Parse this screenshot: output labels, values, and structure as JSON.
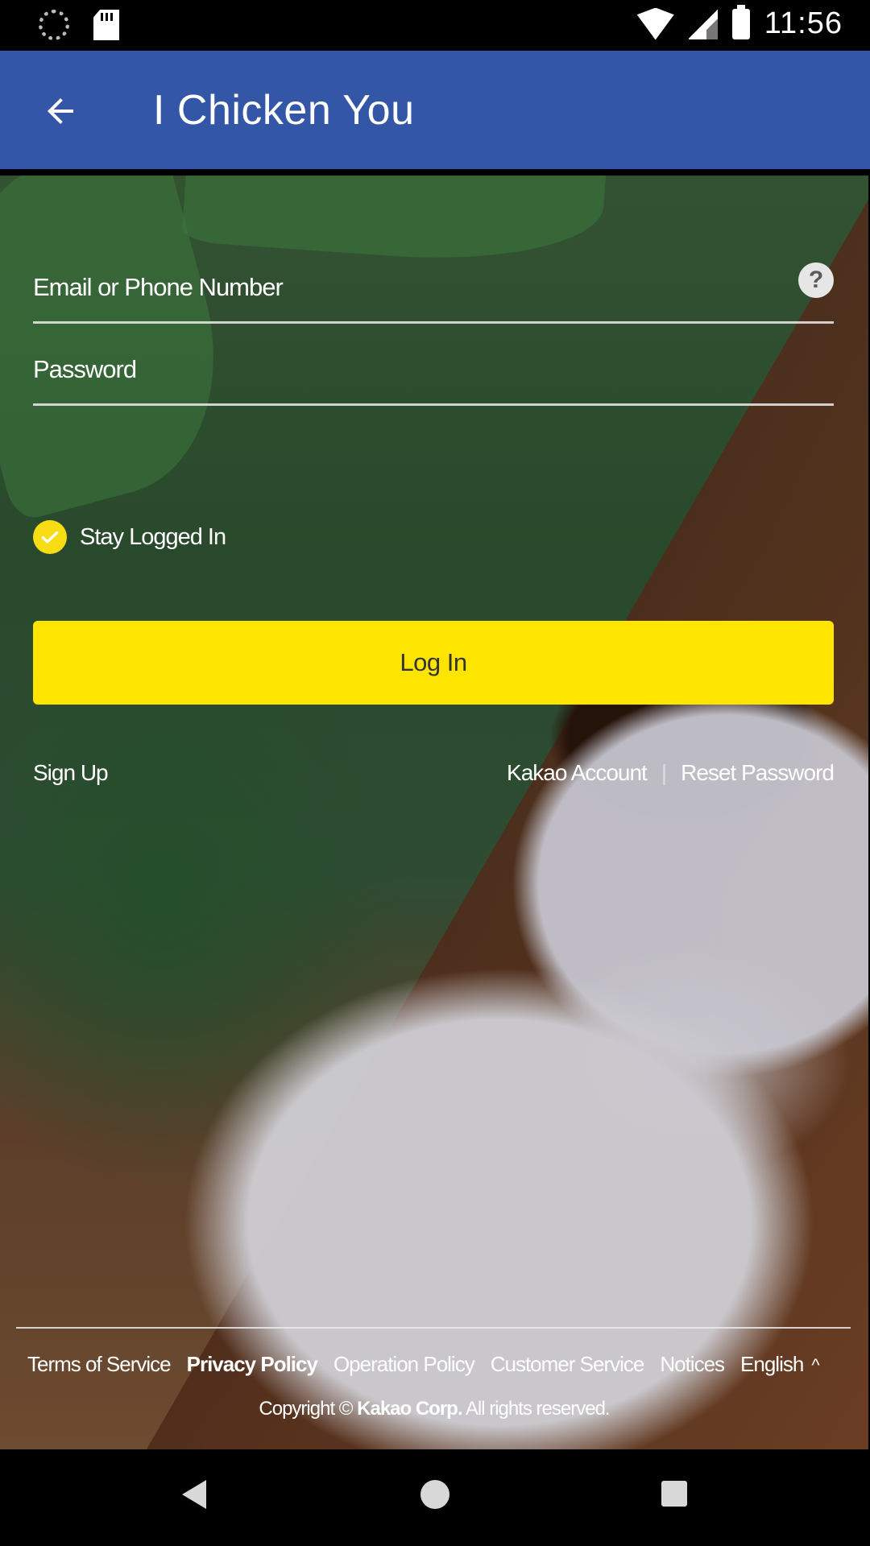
{
  "status_bar": {
    "time": "11:56"
  },
  "app_bar": {
    "title": "I Chicken You"
  },
  "login": {
    "email_placeholder": "Email or Phone Number",
    "password_placeholder": "Password",
    "stay_logged_in": "Stay Logged In",
    "login_button": "Log In",
    "sign_up": "Sign Up",
    "kakao_account": "Kakao Account",
    "separator": "|",
    "reset_password": "Reset Password"
  },
  "footer": {
    "links": [
      "Terms of Service",
      "Privacy Policy",
      "Operation Policy",
      "Customer Service",
      "Notices",
      "English"
    ],
    "copyright_prefix": "Copyright ©",
    "copyright_corp": "Kakao Corp.",
    "copyright_suffix": "All rights reserved."
  },
  "colors": {
    "app_bar": "#3356a6",
    "login_button": "#fee500",
    "check": "#f8dc14"
  },
  "icons": {
    "back": "arrow-left-icon",
    "help": "question-icon",
    "check": "check-icon",
    "language": "caret-up-icon"
  }
}
